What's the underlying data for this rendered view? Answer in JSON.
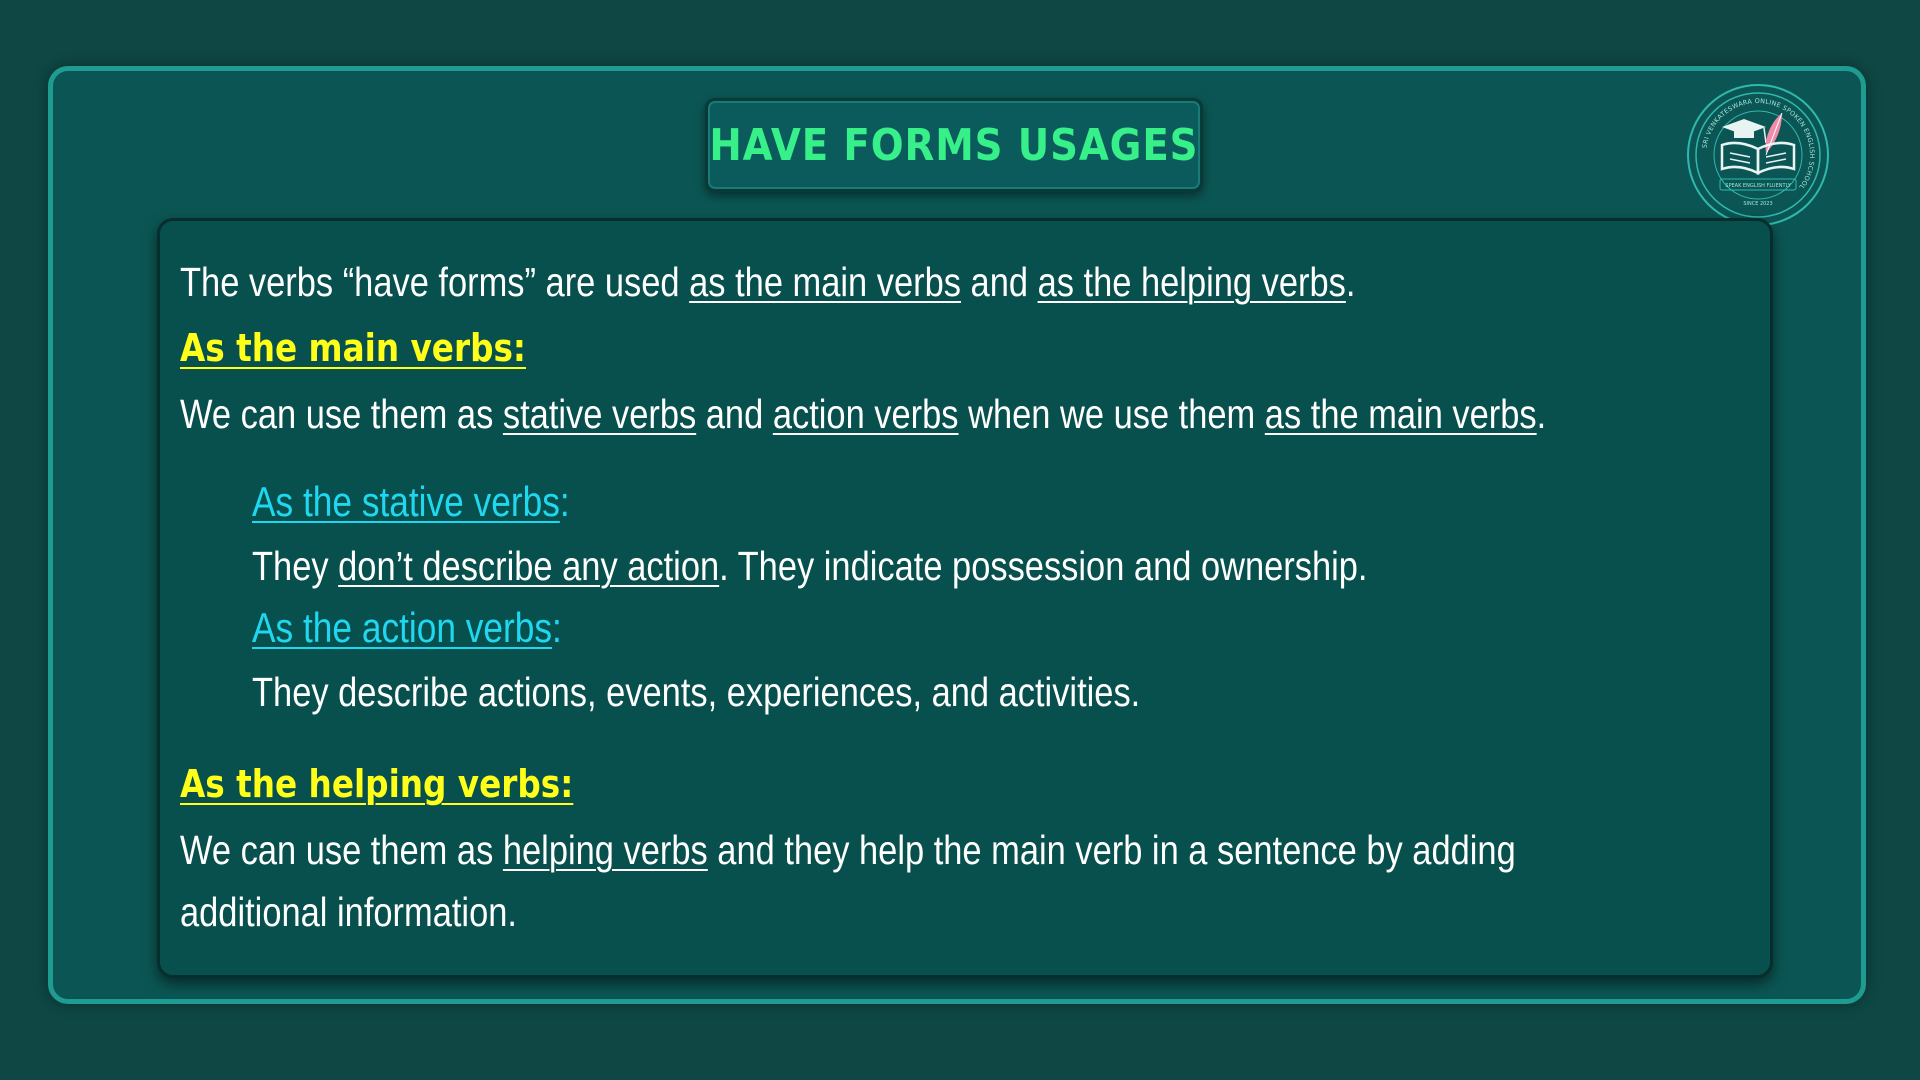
{
  "title": "HAVE FORMS USAGES",
  "logo": {
    "ring_text": "SRI VENKATESWARA ONLINE SPOKEN ENGLISH SCHOOL",
    "banner_text": "SPEAK ENGLISH FLUENTLY",
    "since_text": "SINCE 2023",
    "colors": {
      "ring": "#2fb8ae",
      "emblem": "#e8f4f2",
      "quill": "#f08ca8"
    }
  },
  "intro": {
    "p1": "The verbs “have forms” are used ",
    "u1": "as the main verbs",
    "p2": " and ",
    "u2": "as the helping verbs",
    "p3": "."
  },
  "main_heading": "As the main verbs:",
  "main_desc": {
    "p1": "We can use them as ",
    "u1": "stative verbs",
    "p2": " and ",
    "u2": "action verbs",
    "p3": " when we use them ",
    "u3": "as the main verbs",
    "p4": "."
  },
  "stative": {
    "label": "As the stative verbs",
    "colon": ":",
    "p1": "They ",
    "u1": "don’t describe any action",
    "p2": ". They indicate possession and ownership."
  },
  "action": {
    "label": "As the action verbs",
    "colon": ":",
    "text": "They describe actions, events, experiences, and activities."
  },
  "helping_heading": "As the helping verbs:",
  "helping_desc": {
    "p1": "We can use them as ",
    "u1": "helping verbs",
    "p2": " and they help the main verb in a sentence by adding",
    "line2": "additional information."
  },
  "colors": {
    "background": "#0e4744",
    "frame_border": "#1f9c92",
    "title_green": "#37f08a",
    "heading_yellow": "#ffff1a",
    "subheading_cyan": "#1fd8f0",
    "body_text": "#ffffff"
  }
}
